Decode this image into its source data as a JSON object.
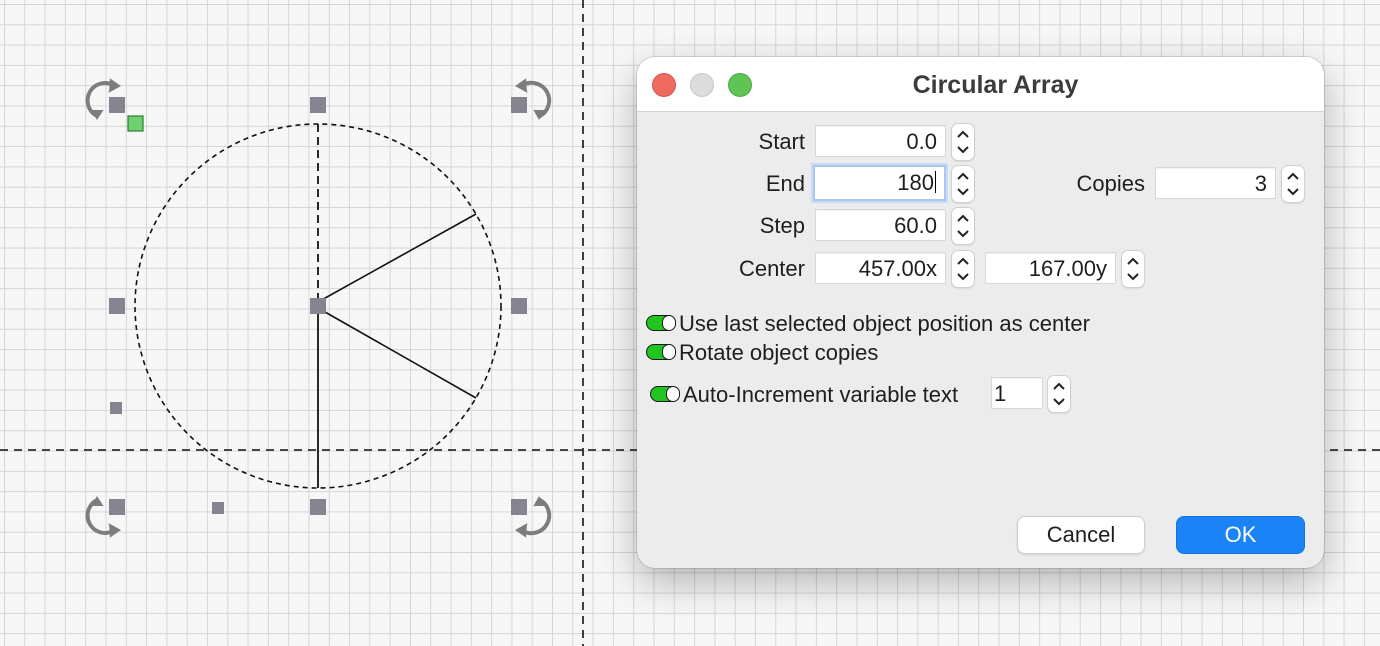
{
  "dialog": {
    "title": "Circular Array",
    "start": {
      "label": "Start",
      "value": "0.0"
    },
    "end": {
      "label": "End",
      "value": "180"
    },
    "step": {
      "label": "Step",
      "value": "60.0"
    },
    "center": {
      "label": "Center",
      "x_value": "457.00x",
      "y_value": "167.00y"
    },
    "copies": {
      "label": "Copies",
      "value": "3"
    },
    "options": {
      "use_last_selected": {
        "label": "Use last selected object position as center",
        "checked": true
      },
      "rotate_copies": {
        "label": "Rotate object copies",
        "checked": true
      },
      "auto_increment": {
        "label": "Auto-Increment variable text",
        "checked": true,
        "value": "1"
      }
    },
    "buttons": {
      "cancel": "Cancel",
      "ok": "OK"
    }
  },
  "colors": {
    "ok_button": "#1a84f6",
    "checkbox_on": "#22c41f",
    "handle": "#858592",
    "selected_handle": "#6fd06f"
  },
  "icons": [
    "rotate-arrow-icon",
    "chevron-up-icon",
    "chevron-down-icon",
    "close-icon"
  ]
}
